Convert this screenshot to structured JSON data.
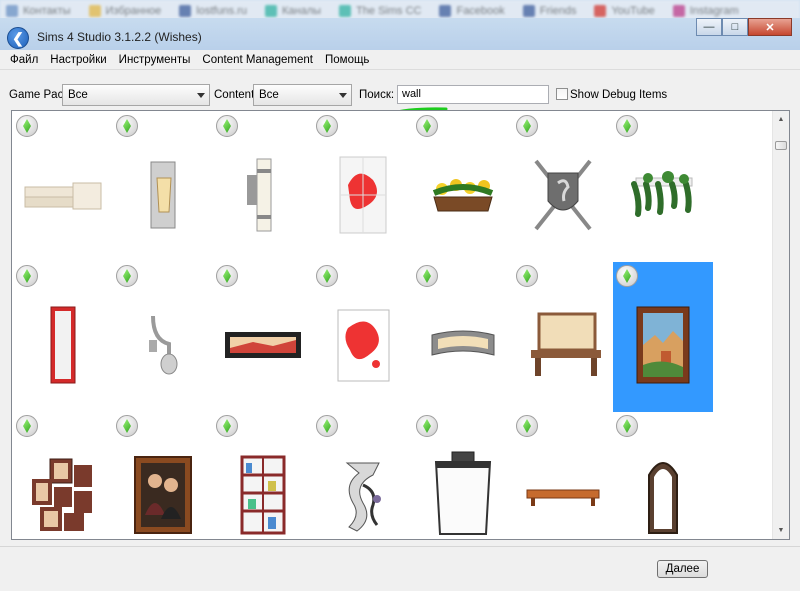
{
  "bookmarks": [
    "Контакты",
    "Избранное",
    "lostfuns.ru",
    "Каналы",
    "The Sims CC",
    "Facebook",
    "Friends",
    "YouTube",
    "Instagram"
  ],
  "window": {
    "title": "Sims 4 Studio 3.1.2.2 (Wishes)"
  },
  "menu": [
    "Файл",
    "Настройки",
    "Инструменты",
    "Content Management",
    "Помощь"
  ],
  "filters": {
    "game_pack_label": "Game Pack",
    "game_pack_value": "Все",
    "content_label": "Content",
    "content_value": "Все",
    "search_label": "Поиск:",
    "search_value": "wall",
    "debug_label": "Show Debug Items"
  },
  "items": [
    {
      "icon": "wall-moulding-icon"
    },
    {
      "icon": "wall-sconce-icon"
    },
    {
      "icon": "cylinder-sconce-icon"
    },
    {
      "icon": "red-splash-panel-icon"
    },
    {
      "icon": "flower-box-icon"
    },
    {
      "icon": "crest-swords-icon"
    },
    {
      "icon": "hanging-ivy-icon"
    },
    {
      "icon": "red-mirror-icon"
    },
    {
      "icon": "curved-lamp-icon"
    },
    {
      "icon": "framed-sunset-icon"
    },
    {
      "icon": "red-splash-canvas-icon"
    },
    {
      "icon": "curved-wall-light-icon"
    },
    {
      "icon": "wall-desk-icon"
    },
    {
      "icon": "village-painting-icon"
    },
    {
      "icon": "photo-collage-icon"
    },
    {
      "icon": "couple-portrait-icon"
    },
    {
      "icon": "bookshelf-icon"
    },
    {
      "icon": "sculpture-icon"
    },
    {
      "icon": "lantern-icon"
    },
    {
      "icon": "wall-shelf-icon"
    },
    {
      "icon": "arch-mirror-icon"
    }
  ],
  "buttons": {
    "next": "Далее"
  }
}
